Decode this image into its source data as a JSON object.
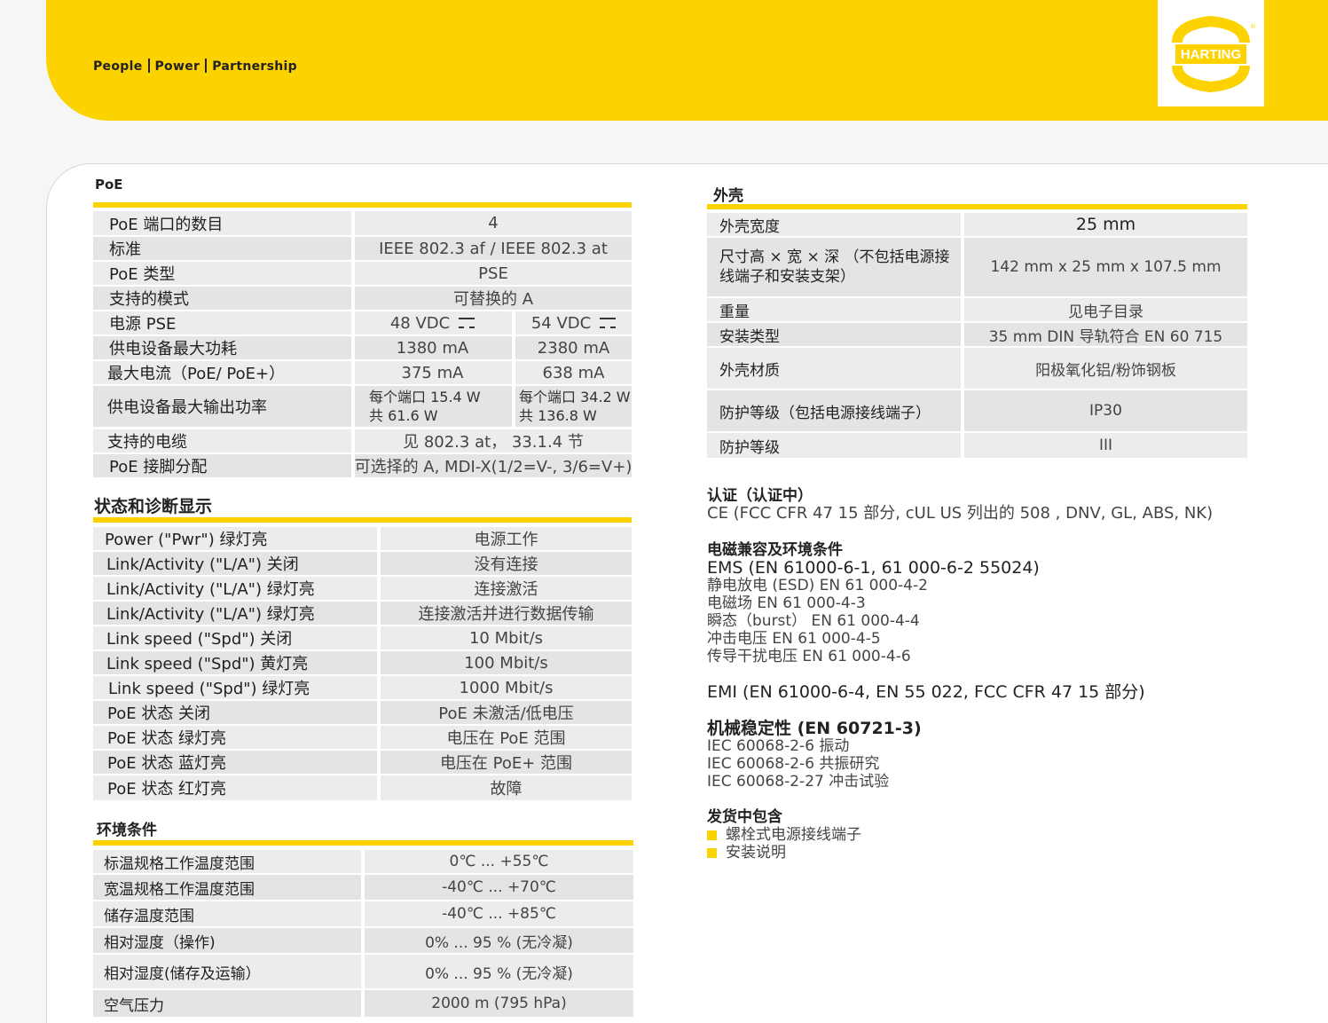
{
  "header": {
    "tagline": [
      "People",
      "Power",
      "Partnership"
    ],
    "logo_text": "HARTING",
    "brand_color": "#fcd200"
  },
  "poe": {
    "title": "PoE",
    "rows": [
      {
        "label": "PoE 端口的数目",
        "value": "4"
      },
      {
        "label": "标准",
        "value": "IEEE 802.3 af / IEEE 802.3 at"
      },
      {
        "label": "PoE 类型",
        "value": "PSE"
      },
      {
        "label": "支持的模式",
        "value": "可替换的 A"
      },
      {
        "label": "电源 PSE",
        "v1": "48 VDC",
        "v2": "54 VDC"
      },
      {
        "label": "供电设备最大功耗",
        "v1": "1380 mA",
        "v2": "2380 mA"
      },
      {
        "label": "最大电流（PoE/ PoE+）",
        "v1": "375 mA",
        "v2": "638 mA"
      },
      {
        "label": "供电设备最大输出功率",
        "v1a": "每个端口 15.4 W",
        "v1b": "共 61.6 W",
        "v2a": "每个端口 34.2 W",
        "v2b": "共 136.8 W"
      },
      {
        "label": "支持的电缆",
        "value": "见 802.3 at， 33.1.4 节"
      },
      {
        "label": "PoE 接脚分配",
        "value": "可选择的 A, MDI-X(1/2=V-, 3/6=V+)"
      }
    ]
  },
  "status": {
    "title": "状态和诊断显示",
    "rows": [
      {
        "label": "Power (\"Pwr\") 绿灯亮",
        "value": "电源工作"
      },
      {
        "label": "Link/Activity (\"L/A\") 关闭",
        "value": "没有连接"
      },
      {
        "label": "Link/Activity (\"L/A\") 绿灯亮",
        "value": "连接激活"
      },
      {
        "label": "Link/Activity (\"L/A\") 绿灯亮",
        "value": "连接激活并进行数据传输"
      },
      {
        "label": "Link speed (\"Spd\") 关闭",
        "value": "10 Mbit/s"
      },
      {
        "label": "Link speed (\"Spd\") 黄灯亮",
        "value": "100 Mbit/s"
      },
      {
        "label": "Link speed (\"Spd\") 绿灯亮",
        "value": "1000 Mbit/s"
      },
      {
        "label": "PoE 状态 关闭",
        "value": "PoE 未激活/低电压"
      },
      {
        "label": "PoE 状态 绿灯亮",
        "value": "电压在 PoE 范围"
      },
      {
        "label": "PoE 状态 蓝灯亮",
        "value": "电压在 PoE+ 范围"
      },
      {
        "label": "PoE 状态 红灯亮",
        "value": "故障"
      }
    ]
  },
  "env": {
    "title": "环境条件",
    "rows": [
      {
        "label": "标温规格工作温度范围",
        "value": "0℃ ... +55℃"
      },
      {
        "label": "宽温规格工作温度范围",
        "value": "-40℃ ... +70℃"
      },
      {
        "label": "储存温度范围",
        "value": "-40℃ ... +85℃"
      },
      {
        "label": "相对湿度（操作)",
        "value": "0% ... 95 % (无冷凝)"
      },
      {
        "label": "相对湿度(储存及运输）",
        "value": "0% ... 95 % (无冷凝)"
      },
      {
        "label": "空气压力",
        "value": "2000 m (795 hPa)"
      }
    ]
  },
  "housing": {
    "title": "外壳",
    "rows": [
      {
        "label": "外壳宽度",
        "value": "25 mm"
      },
      {
        "label_a": "尺寸高 × 宽 × 深 （不包括电源接",
        "label_b": "线端子和安装支架）",
        "value": "142 mm x 25 mm x 107.5 mm"
      },
      {
        "label": "重量",
        "value": "见电子目录"
      },
      {
        "label": "安装类型",
        "value": "35 mm DIN 导轨符合 EN 60 715"
      },
      {
        "label": "外壳材质",
        "value": "阳极氧化铝/粉饰钢板"
      },
      {
        "label": "防护等级（包括电源接线端子）",
        "value": "IP30"
      },
      {
        "label": "防护等级",
        "value": "III"
      }
    ]
  },
  "cert": {
    "title": "认证（认证中）",
    "text": "CE (FCC CFR 47 15 部分, cUL US 列出的 508 , DNV, GL, ABS, NK)"
  },
  "emc": {
    "title": "电磁兼容及环境条件",
    "ems": "EMS (EN 61000-6-1, 61 000-6-2 55024)",
    "lines": [
      "静电放电 (ESD) EN 61 000-4-2",
      "电磁场 EN 61 000-4-3",
      "瞬态（burst） EN 61 000-4-4",
      "冲击电压 EN 61 000-4-5",
      "传导干扰电压 EN 61 000-4-6"
    ],
    "emi": "EMI (EN 61000-6-4, EN 55 022, FCC CFR 47 15 部分)"
  },
  "mech": {
    "title": "机械稳定性 (EN 60721-3)",
    "lines": [
      "IEC 60068-2-6 振动",
      "IEC 60068-2-6 共振研究",
      "IEC 60068-2-27 冲击试验"
    ]
  },
  "delivery": {
    "title": "发货中包含",
    "items": [
      "螺栓式电源接线端子",
      "安装说明"
    ]
  }
}
